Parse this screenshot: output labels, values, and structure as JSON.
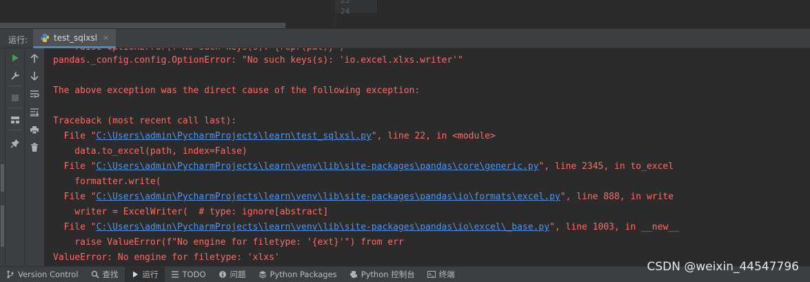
{
  "editor": {
    "gutter_line_numbers": [
      "23",
      "24"
    ]
  },
  "run_window": {
    "label": "运行:",
    "tab_name": "test_sqlxsl",
    "tab_close": "×"
  },
  "console": {
    "partial_top_line": "    raise OptionError(f\"No such keys(s): {repr(pat)}\")",
    "lines": [
      {
        "text": "pandas._config.config.OptionError: \"No such keys(s): 'io.excel.xlxs.writer'\""
      },
      {
        "text": ""
      },
      {
        "text": "The above exception was the direct cause of the following exception:"
      },
      {
        "text": ""
      },
      {
        "text": "Traceback (most recent call last):"
      },
      {
        "pre": "  File \"",
        "link": "C:\\Users\\admin\\PycharmProjects\\learn\\test_sqlxsl.py",
        "post": "\", line 22, in <module>"
      },
      {
        "text": "    data.to_excel(path, index=False)"
      },
      {
        "pre": "  File \"",
        "link": "C:\\Users\\admin\\PycharmProjects\\learn\\venv\\lib\\site-packages\\pandas\\core\\generic.py",
        "post": "\", line 2345, in to_excel"
      },
      {
        "text": "    formatter.write("
      },
      {
        "pre": "  File \"",
        "link": "C:\\Users\\admin\\PycharmProjects\\learn\\venv\\lib\\site-packages\\pandas\\io\\formats\\excel.py",
        "post": "\", line 888, in write"
      },
      {
        "text": "    writer = ExcelWriter(  # type: ignore[abstract]"
      },
      {
        "pre": "  File \"",
        "link": "C:\\Users\\admin\\PycharmProjects\\learn\\venv\\lib\\site-packages\\pandas\\io\\excel\\_base.py",
        "post": "\", line 1003, in __new__"
      },
      {
        "text": "    raise ValueError(f\"No engine for filetype: '{ext}'\") from err"
      },
      {
        "text": "ValueError: No engine for filetype: 'xlxs'"
      }
    ]
  },
  "bottom_bar": {
    "items": [
      {
        "label": "Version Control",
        "icon": "branch-icon"
      },
      {
        "label": "查找",
        "icon": "search-icon"
      },
      {
        "label": "运行",
        "icon": "run-icon"
      },
      {
        "label": "TODO",
        "icon": "list-icon"
      },
      {
        "label": "问题",
        "icon": "info-icon"
      },
      {
        "label": "Python Packages",
        "icon": "layers-icon"
      },
      {
        "label": "Python 控制台",
        "icon": "python-icon"
      },
      {
        "label": "终端",
        "icon": "terminal-icon"
      }
    ],
    "active_item": "运行"
  },
  "watermark": "CSDN @weixin_44547796",
  "colors": {
    "error_text": "#ff6b68",
    "link_text": "#5394ec",
    "run_green": "#499c54",
    "tab_underline": "#4a88c7"
  }
}
